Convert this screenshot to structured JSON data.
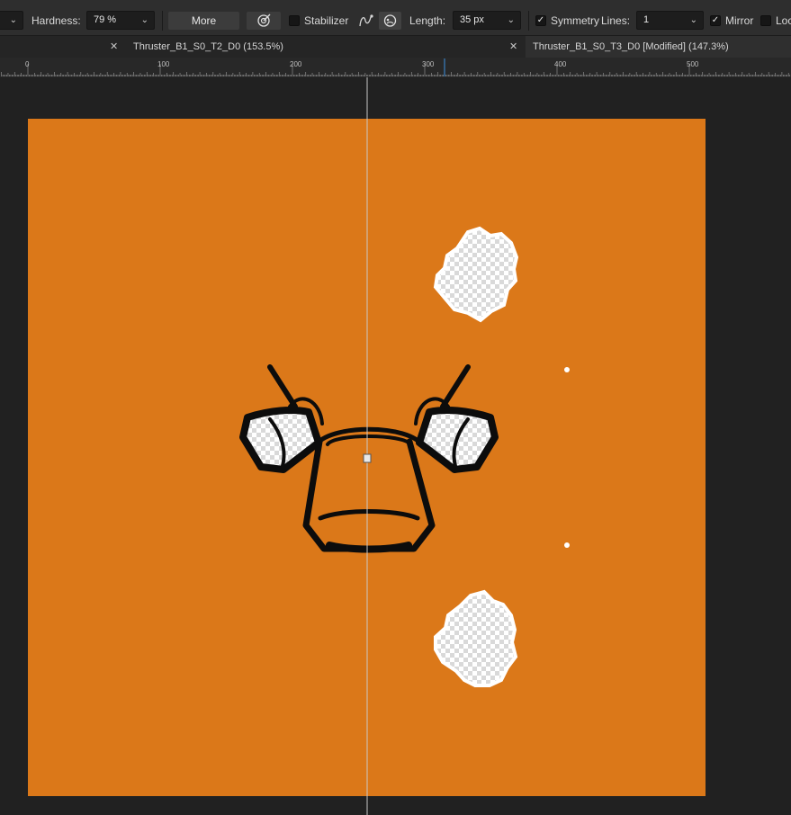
{
  "toolbar": {
    "hardness_label": "Hardness:",
    "hardness_value": "79 %",
    "more_label": "More",
    "stabilizer_label": "Stabilizer",
    "length_label": "Length:",
    "length_value": "35 px",
    "symmetry_label": "Symmetry",
    "lines_label": "Lines:",
    "lines_value": "1",
    "mirror_label": "Mirror",
    "lock_label": "Loc",
    "symmetry_checked": true,
    "mirror_checked": true
  },
  "tabs": [
    {
      "title": "Thruster_B1_S0_T2_D0 (153.5%)",
      "active": false
    },
    {
      "title": "Thruster_B1_S0_T3_D0 [Modified] (147.3%)",
      "active": true
    }
  ],
  "ruler": {
    "labels": [
      "0",
      "100",
      "200",
      "300",
      "400",
      "500"
    ]
  },
  "colors": {
    "canvas_fill": "#db7819",
    "ink": "#0c0c0c",
    "panel": "#2e2e2e",
    "workspace": "#212121",
    "symmetry_line": "#c8c8c8"
  },
  "icons": {
    "brush_icon": "target-brush-icon",
    "stroke_icon": "pen-stroke-icon",
    "stroke_mode_icon": "smooth-stroke-icon"
  }
}
